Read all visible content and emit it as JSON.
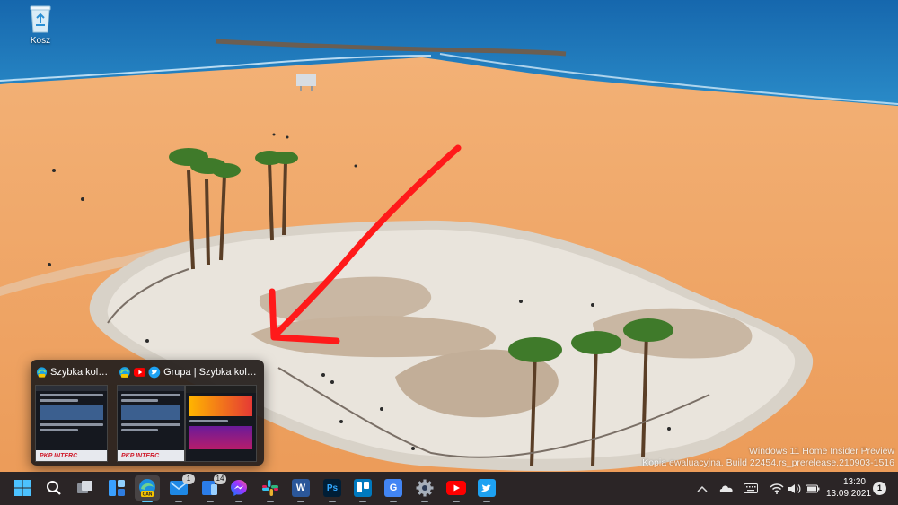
{
  "desktop": {
    "recycle_bin_label": "Kosz",
    "watermark_line1": "Windows 11 Home Insider Preview",
    "watermark_line2": "Kopia ewaluacyjna. Build 22454.rs_prerelease.210903-1516"
  },
  "preview": {
    "thumb1_title": "Szybka kolej...",
    "thumb2_title": "Grupa | Szybka kolej...",
    "site_logo": "PKP INTERC",
    "thumb1_icons": [
      "edge-can-icon"
    ],
    "thumb2_icons": [
      "edge-can-icon",
      "youtube-icon",
      "twitter-icon"
    ]
  },
  "taskbar": {
    "items": [
      {
        "name": "start-button",
        "icon": "windows-logo-icon"
      },
      {
        "name": "search-button",
        "icon": "search-icon"
      },
      {
        "name": "task-view-button",
        "icon": "task-view-icon"
      },
      {
        "name": "widgets-button",
        "icon": "widgets-icon"
      },
      {
        "name": "edge-canary-button",
        "icon": "edge-canary-icon",
        "badge_text": "CAN",
        "active": true
      },
      {
        "name": "mail-button",
        "icon": "mail-icon",
        "badge": "1"
      },
      {
        "name": "phone-link-button",
        "icon": "phone-link-icon",
        "badge": "14"
      },
      {
        "name": "messenger-button",
        "icon": "messenger-icon"
      },
      {
        "name": "slack-button",
        "icon": "slack-icon"
      },
      {
        "name": "word-button",
        "icon": "word-icon",
        "letter": "W"
      },
      {
        "name": "photoshop-button",
        "icon": "photoshop-icon",
        "letter": "Ps"
      },
      {
        "name": "trello-button",
        "icon": "trello-icon"
      },
      {
        "name": "translate-button",
        "icon": "google-translate-icon",
        "letter": "G"
      },
      {
        "name": "settings-button",
        "icon": "gear-icon"
      },
      {
        "name": "youtube-button",
        "icon": "youtube-icon"
      },
      {
        "name": "twitter-button",
        "icon": "twitter-icon"
      }
    ],
    "tray": {
      "icons": [
        "chevron-up-icon",
        "onedrive-icon",
        "keyboard-icon",
        "wifi-icon",
        "volume-icon",
        "battery-icon"
      ],
      "time": "13:20",
      "date": "13.09.2021",
      "notifications": "1"
    }
  },
  "colors": {
    "sea": "#1e72b4",
    "sand": "#f2a869",
    "arrow": "#ff1a1a",
    "taskbar": "#1c1c22",
    "accent": "#60cdff"
  }
}
